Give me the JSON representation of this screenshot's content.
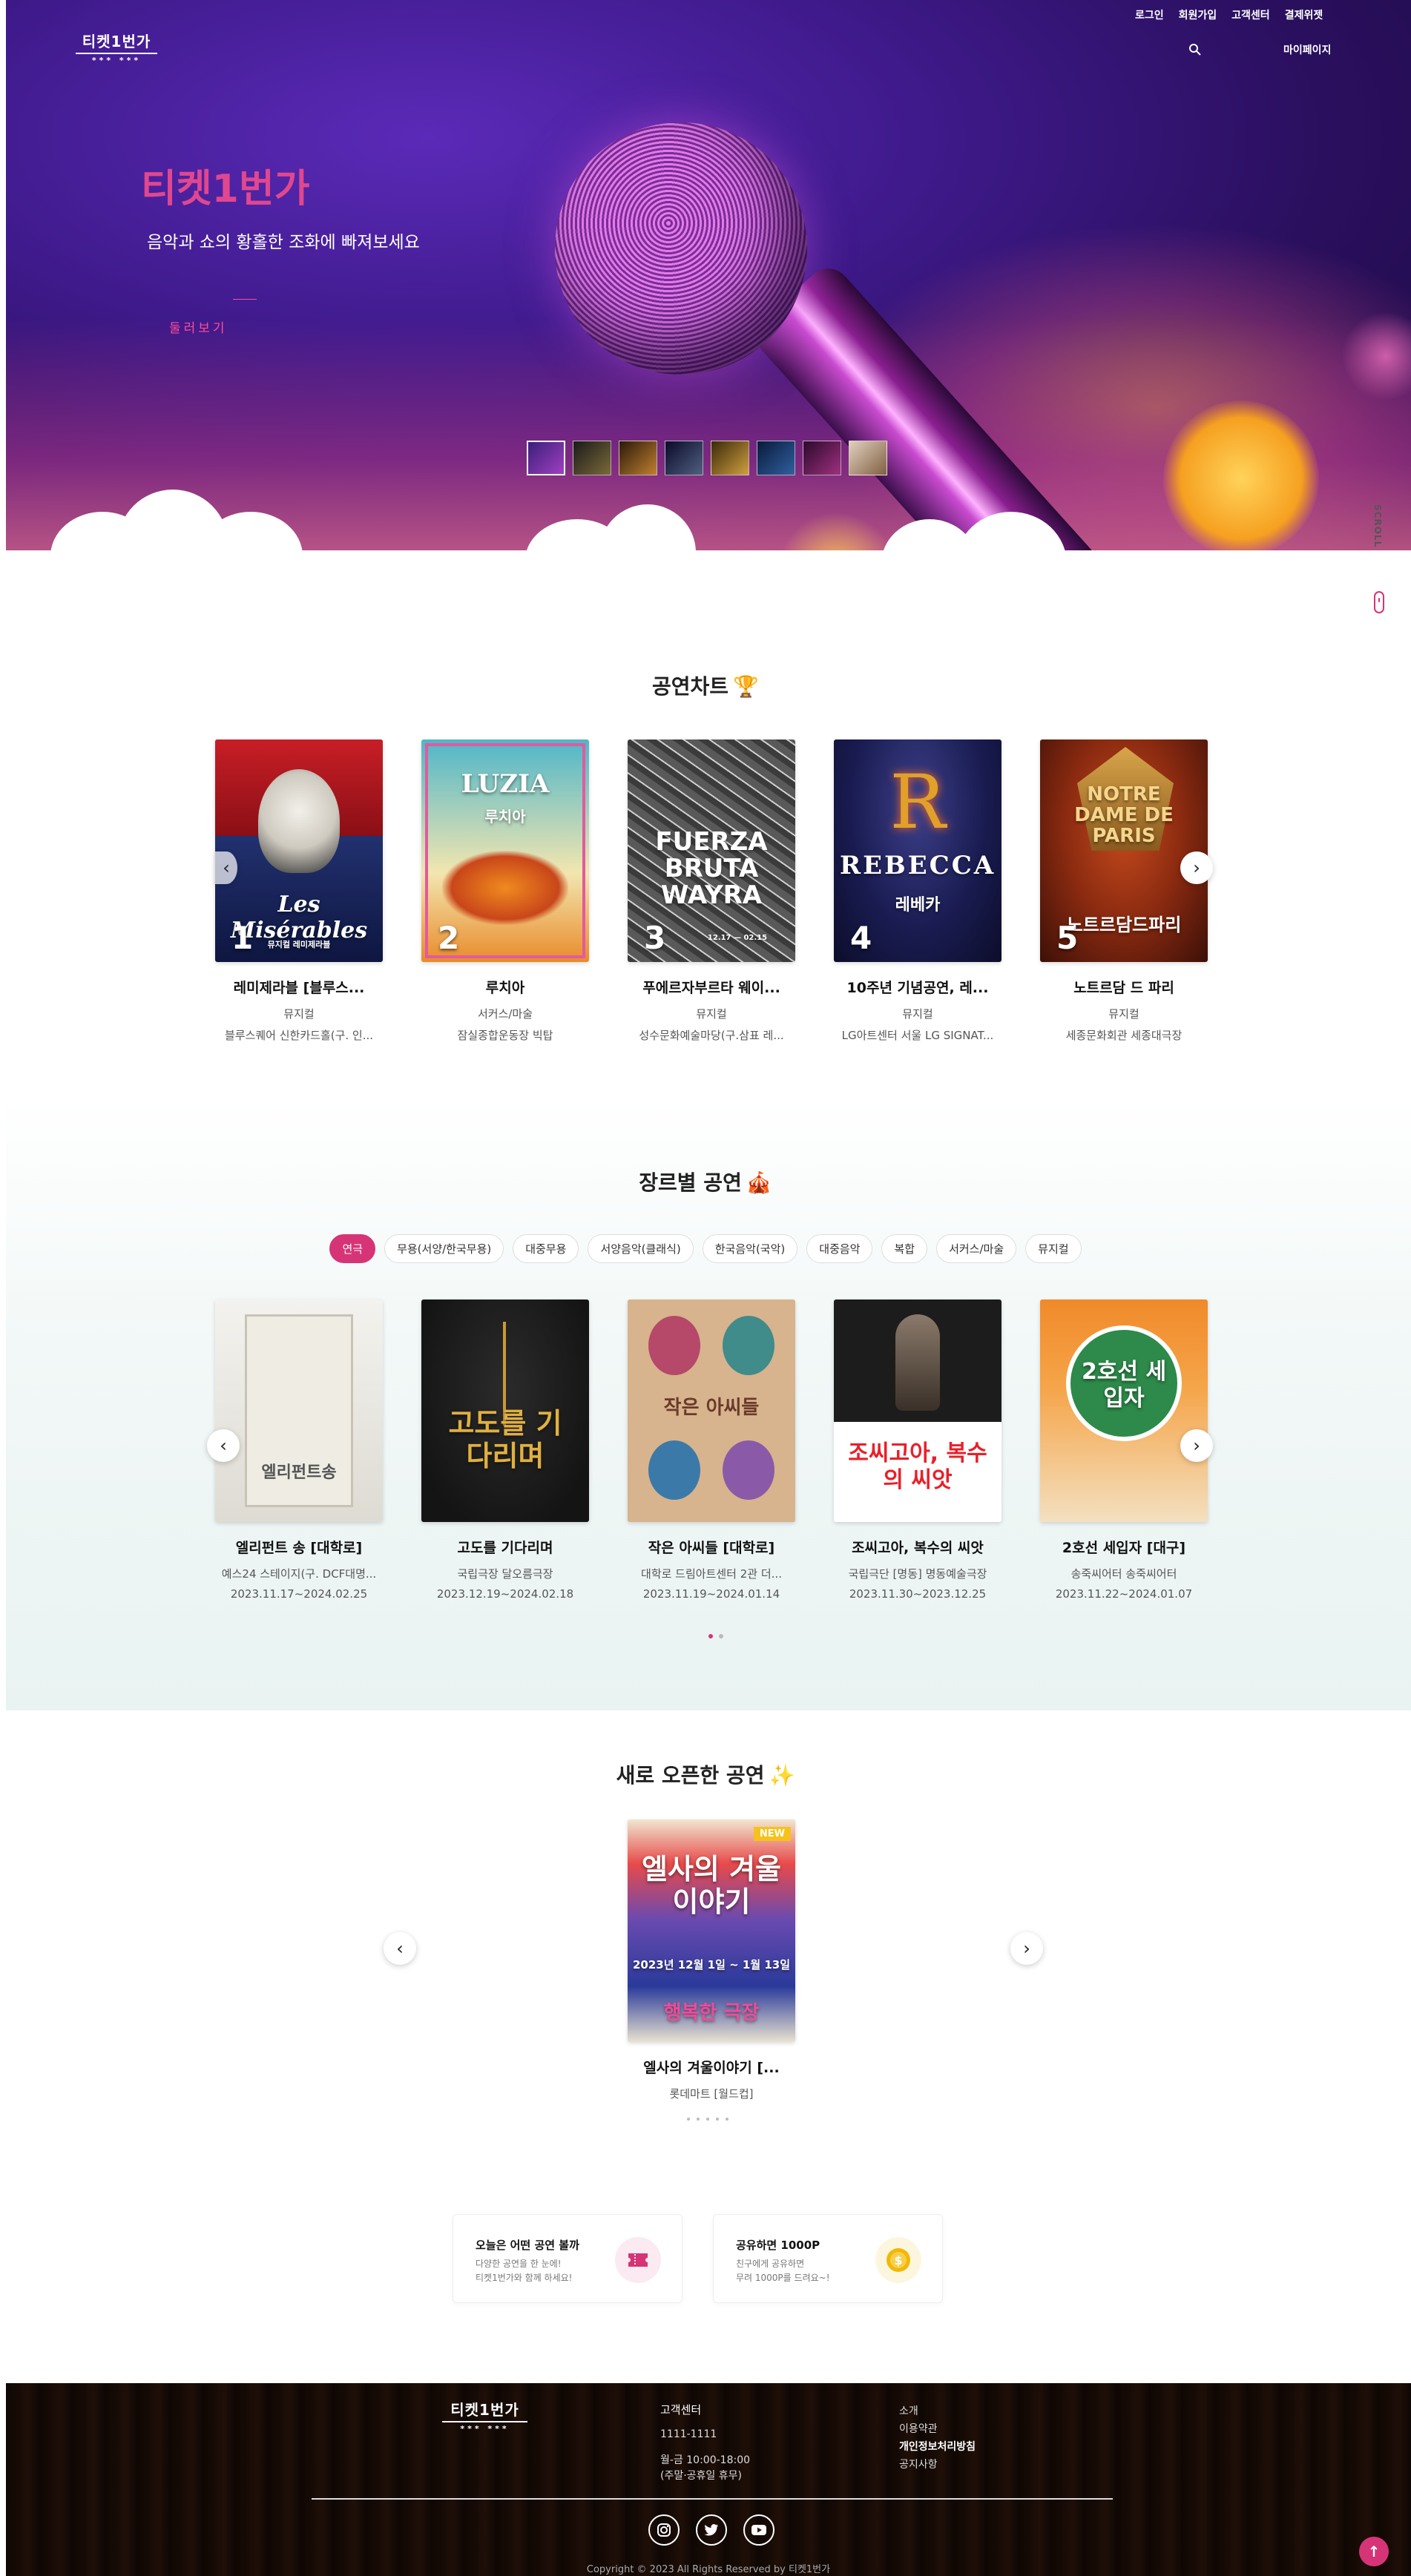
{
  "brand": {
    "logo_text": "티켓1번가",
    "logo_dots": "*** ***",
    "accent_color": "#d63476",
    "title_color": "#e0478f"
  },
  "topnav": {
    "items": [
      "로그인",
      "회원가입",
      "고객센터",
      "결제위젯"
    ],
    "search_icon": "search-icon",
    "mypage": "마이페이지"
  },
  "hero": {
    "title": "티켓1번가",
    "subtitle": "음악과 쇼의 황홀한 조화에 빠져보세요",
    "button": "둘러보기",
    "thumbnails": 8,
    "active_thumbnail": 1
  },
  "side_scroll": {
    "label": "SCROLL"
  },
  "chart": {
    "title": "공연차트",
    "emoji": "🏆",
    "items": [
      {
        "rank": "1",
        "title": "레미제라블 [블루스...",
        "genre": "뮤지컬",
        "venue": "블루스퀘어 신한카드홀(구. 인...",
        "poster_text": "Les Misérables",
        "poster_sub": "뮤지컬 레미제라블"
      },
      {
        "rank": "2",
        "title": "루치아",
        "genre": "서커스/마술",
        "venue": "잠실종합운동장 빅탑",
        "poster_text": "LUZIA",
        "poster_sub": "루치아"
      },
      {
        "rank": "3",
        "title": "푸에르자부르타 웨이...",
        "genre": "뮤지컬",
        "venue": "성수문화예술마당(구.삼표 레...",
        "poster_text": "FUERZA BRUTA WAYRA",
        "poster_sub": "12.17 — 02.15"
      },
      {
        "rank": "4",
        "title": "10주년 기념공연, 레...",
        "genre": "뮤지컬",
        "venue": "LG아트센터 서울 LG SIGNAT...",
        "poster_text": "REBECCA",
        "poster_sub": "레베카"
      },
      {
        "rank": "5",
        "title": "노트르담 드 파리",
        "genre": "뮤지컬",
        "venue": "세종문화회관 세종대극장",
        "poster_text": "NOTRE DAME DE PARIS",
        "poster_sub": "노트르담드파리"
      }
    ],
    "prev_icon": "chevron-left-icon",
    "next_icon": "chevron-right-icon"
  },
  "genre": {
    "title": "장르별 공연",
    "emoji": "🎪",
    "tabs": [
      "연극",
      "무용(서양/한국무용)",
      "대중무용",
      "서양음악(클래식)",
      "한국음악(국악)",
      "대중음악",
      "복합",
      "서커스/마술",
      "뮤지컬"
    ],
    "active_tab": 0,
    "items": [
      {
        "title": "엘리펀트 송 [대학로]",
        "venue": "예스24 스테이지(구. DCF대명...",
        "date": "2023.11.17~2024.02.25",
        "poster_text": "엘리펀트송"
      },
      {
        "title": "고도를 기다리며",
        "venue": "국립극장 달오름극장",
        "date": "2023.12.19~2024.02.18",
        "poster_text": "고도를 기다리며"
      },
      {
        "title": "작은 아씨들 [대학로]",
        "venue": "대학로 드림아트센터 2관 더...",
        "date": "2023.11.19~2024.01.14",
        "poster_text": "작은 아씨들"
      },
      {
        "title": "조씨고아, 복수의 씨앗",
        "venue": "국립극단 [명동] 명동예술극장",
        "date": "2023.11.30~2023.12.25",
        "poster_text": "조씨고아, 복수의 씨앗"
      },
      {
        "title": "2호선 세입자 [대구]",
        "venue": "송죽씨어터 송죽씨어터",
        "date": "2023.11.22~2024.01.07",
        "poster_text": "2호선 세입자"
      }
    ],
    "pages": 2,
    "active_page": 0
  },
  "new_open": {
    "title": "새로 오픈한 공연",
    "emoji": "✨",
    "item": {
      "title": "엘사의 겨울이야기 [...",
      "venue": "롯데마트 [월드컵]",
      "poster_text": "엘사의 겨울이야기",
      "poster_badge": "NEW",
      "poster_date": "2023년 12월 1일 ~ 1월 13일",
      "poster_brand": "행복한 극장"
    },
    "pages": 5,
    "active_page": 0
  },
  "info_boxes": [
    {
      "title": "오늘은 어떤 공연 볼까",
      "desc": "다양한 공연을 한 눈에!\n티켓1번가와 함께 하세요!",
      "icon": "ticket-icon",
      "icon_color": "#d63476",
      "bg_color": "#fbeaf1"
    },
    {
      "title": "공유하면 1000P",
      "desc": "친구에게 공유하면\n무려 1000P를 드려요~!",
      "icon": "coin-icon",
      "icon_color": "#f2b807",
      "bg_color": "#fdf6de"
    }
  ],
  "footer": {
    "cs_title": "고객센터",
    "cs_phone": "1111-1111",
    "cs_hours": "월-금 10:00-18:00",
    "cs_holiday": "(주말·공휴일 휴무)",
    "links": [
      "소개",
      "이용약관",
      "개인정보처리방침",
      "공지사항"
    ],
    "sns": [
      "instagram-icon",
      "twitter-icon",
      "youtube-icon"
    ],
    "copyright": "Copyright © 2023 All Rights Reserved by 티켓1번가"
  },
  "to_top_icon": "arrow-up-icon"
}
